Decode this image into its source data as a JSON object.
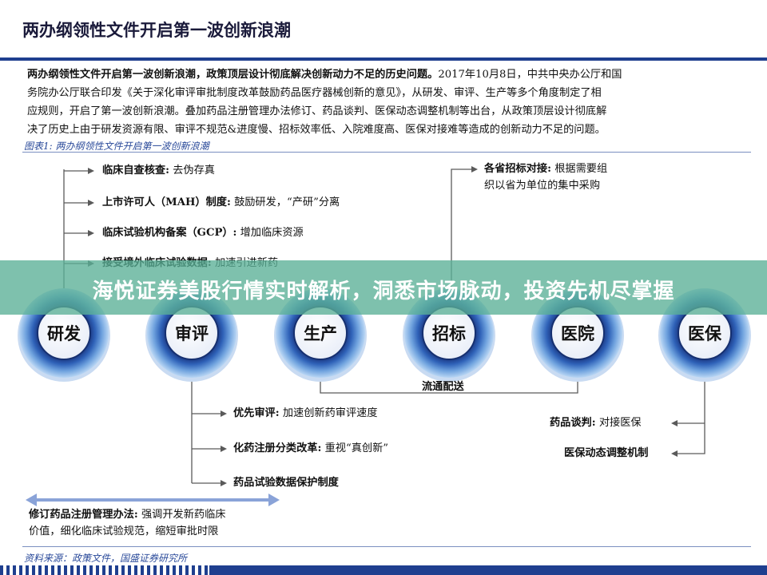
{
  "header": {
    "title": "两办纲领性文件开启第一波创新浪潮"
  },
  "intro": {
    "lead": "两办纲领性文件开启第一波创新浪潮，政策顶层设计彻底解决创新动力不足的历史问题。",
    "line1_rest": "2017年10月8日，中共中央办公厅和国",
    "line2": "务院办公厅联合印发《关于深化审评审批制度改革鼓励药品医疗器械创新的意见》，从研发、审评、生产等多个角度制定了相",
    "line3": "应规则，开启了第一波创新浪潮。叠加药品注册管理办法修订、药品谈判、医保动态调整机制等出台，从政策顶层设计彻底解",
    "line4": "决了历史上由于研发资源有限、审评不规范&进度慢、招标效率低、入院难度高、医保对接难等造成的创新动力不足的问题。"
  },
  "figure": {
    "label": "图表1: 两办纲领性文件开启第一波创新浪潮"
  },
  "stages": [
    {
      "label": "研发"
    },
    {
      "label": "审评"
    },
    {
      "label": "生产"
    },
    {
      "label": "招标"
    },
    {
      "label": "医院"
    },
    {
      "label": "医保"
    }
  ],
  "rd_items": [
    {
      "key": "临床自查核查:",
      "value": "去伪存真"
    },
    {
      "key": "上市许可人（MAH）制度:",
      "value": "鼓励研发，“产研”分离"
    },
    {
      "key": "临床试验机构备案（GCP）:",
      "value": "增加临床资源"
    },
    {
      "key": "接受境外临床试验数据:",
      "value": "加速引进新药"
    }
  ],
  "tender_items": [
    {
      "key": "各省招标对接:",
      "value_line1": "根据需要组",
      "value_line2": "织以省为单位的集中采购"
    }
  ],
  "review_items": [
    {
      "key": "优先审评:",
      "value": "加速创新药审评速度"
    },
    {
      "key": "化药注册分类改革:",
      "value": "重视“真创新”"
    },
    {
      "key": "药品试验数据保护制度",
      "value": ""
    }
  ],
  "flow": {
    "label": "流通配送"
  },
  "insurance_items": [
    {
      "key": "药品谈判:",
      "value": "对接医保"
    },
    {
      "key": "医保动态调整机制",
      "value": ""
    }
  ],
  "registration": {
    "key": "修订药品注册管理办法:",
    "value_line1": "强调开发新药临床",
    "value_line2": "价值，细化临床试验规范，缩短审批时限"
  },
  "source": {
    "text": "资料来源：政策文件，国盛证券研究所"
  },
  "banner": {
    "text": "海悦证券美股行情实时解析，洞悉市场脉动，投资先机尽掌握"
  },
  "colors": {
    "brand_blue": "#1f3f8f",
    "ring_dark": "#1f3f8f",
    "ring_mid": "#3f7fd0",
    "ring_light": "#9cc4ee",
    "banner": "#5ab096"
  }
}
